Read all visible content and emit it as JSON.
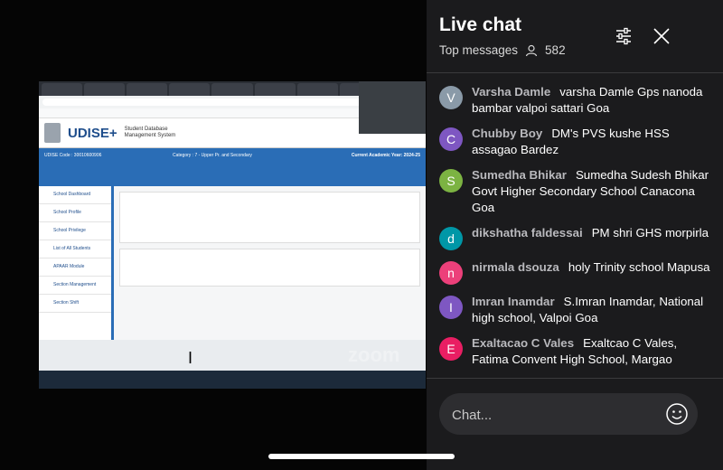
{
  "chat": {
    "title": "Live chat",
    "filter_label": "Top messages",
    "viewer_count": "582",
    "input_placeholder": "Chat...",
    "messages": [
      {
        "initial": "V",
        "color": "#8a9aa8",
        "author": "Varsha Damle",
        "text": "varsha Damle Gps nanoda bambar valpoi sattari Goa"
      },
      {
        "initial": "C",
        "color": "#7e57c2",
        "author": "Chubby Boy",
        "text": "DM's PVS kushe HSS assagao Bardez"
      },
      {
        "initial": "S",
        "color": "#7cb342",
        "author": "Sumedha Bhikar",
        "text": "Sumedha Sudesh Bhikar Govt Higher Secondary School Canacona Goa"
      },
      {
        "initial": "d",
        "color": "#0097a7",
        "author": "dikshatha faldessai",
        "text": "PM shri GHS morpirla"
      },
      {
        "initial": "n",
        "color": "#ec407a",
        "author": "nirmala dsouza",
        "text": "holy Trinity school Mapusa"
      },
      {
        "initial": "I",
        "color": "#7e57c2",
        "author": "Imran Inamdar",
        "text": "S.Imran Inamdar, National high school, Valpoi Goa"
      },
      {
        "initial": "E",
        "color": "#e91e63",
        "author": "Exaltacao C Vales",
        "text": "Exaltcao C Vales, Fatima Convent High School, Margao"
      }
    ]
  },
  "shared_screen": {
    "logo": "UDISE+",
    "logo_subtitle": "Student Database Management System",
    "band_left": "UDISE Code : 30010600906",
    "band_mid": "Category : 7 - Upper Pr. and Secondary",
    "band_right": "Current Academic Year: 2024-25",
    "sidebar_items": [
      "School Dashboard",
      "School Profile",
      "School Privilege",
      "List of All Students",
      "APAAR Module",
      "Section Management",
      "Section Shift"
    ],
    "watermark": "zoom"
  },
  "colors": {
    "chat_bg": "#1b1b1d",
    "udise_blue": "#2a6db6"
  }
}
